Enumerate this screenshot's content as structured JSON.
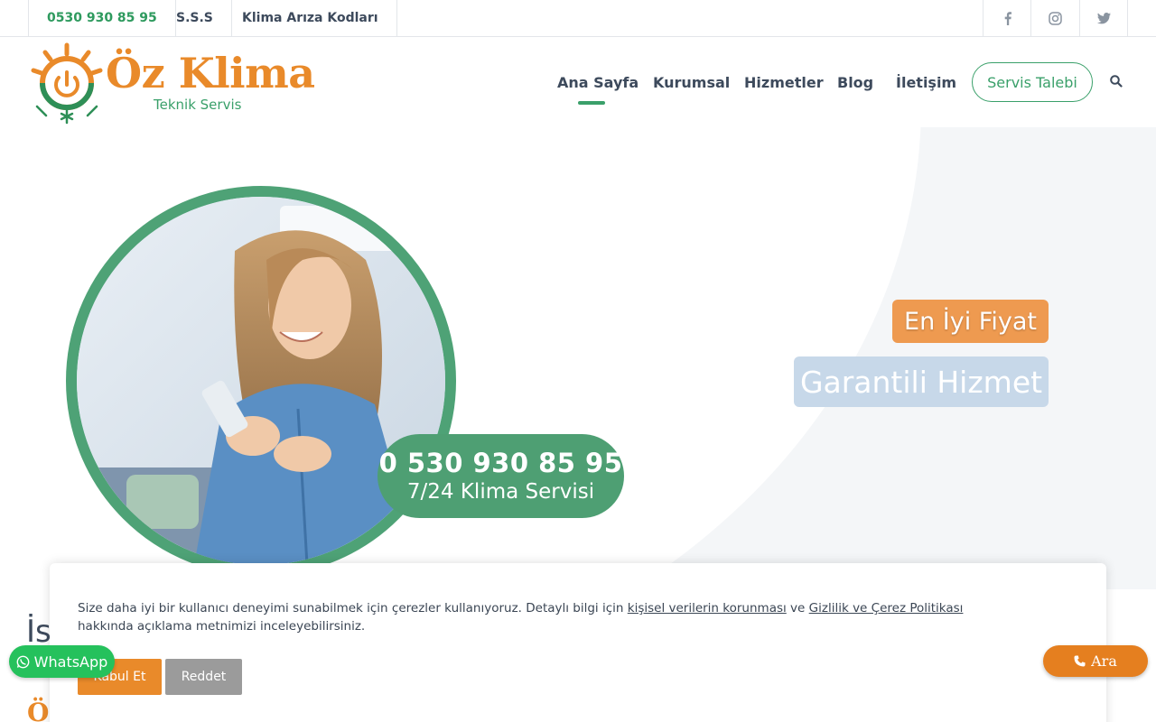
{
  "topbar": {
    "phone": "0530 930 85 95",
    "sss": "S.S.S",
    "codes": "Klima Arıza Kodları",
    "social": [
      "facebook-icon",
      "instagram-icon",
      "twitter-icon"
    ]
  },
  "header": {
    "logo_title": "Öz Klima",
    "logo_subtitle": "Teknik Servis",
    "nav": [
      "Ana Sayfa",
      "Kurumsal",
      "Hizmetler",
      "Blog",
      "İletişim"
    ],
    "active_nav": "Ana Sayfa",
    "cta": "Servis Talebi",
    "search_icon": "search-icon"
  },
  "hero": {
    "phone": "0 530 930 85 95",
    "phone_sub": "7/24 Klima Servisi",
    "badge_price": "En İyi Fiyat",
    "badge_guarantee": "Garantili Hizmet"
  },
  "below": {
    "heading_partial": "İs",
    "logo_partial": "Öz"
  },
  "cookie": {
    "text_before": "Size daha iyi bir kullanıcı deneyimi sunabilmek için çerezler kullanıyoruz. Detaylı bilgi için ",
    "link1": "kişisel verilerin korunması",
    "text_mid": " ve ",
    "link2": "Gizlilik ve Çerez Politikası",
    "text_after": " hakkında açıklama metnimizi inceleyebilirsiniz.",
    "accept": "Kabul Et",
    "reject": "Reddet"
  },
  "floating": {
    "whatsapp": "WhatsApp",
    "call": "Ara"
  },
  "colors": {
    "green": "#3aa06a",
    "orange": "#e98a2a",
    "whatsapp": "#25c15c"
  }
}
